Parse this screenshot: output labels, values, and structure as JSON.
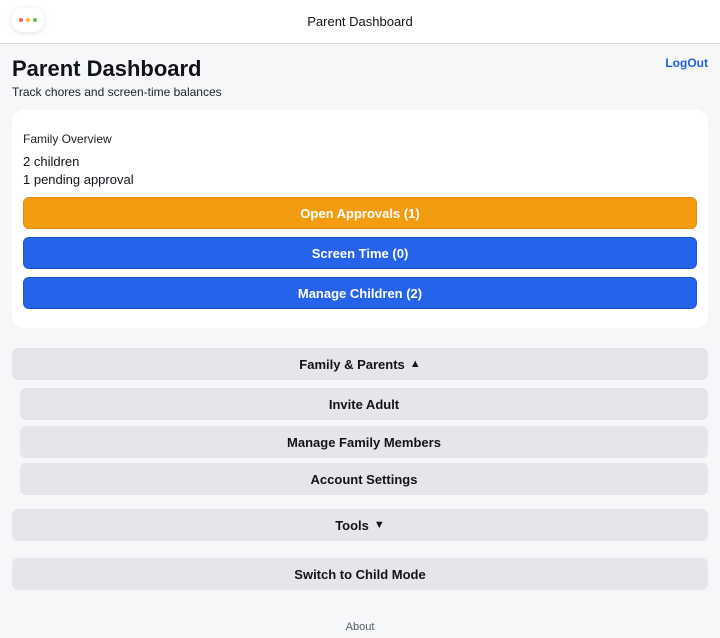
{
  "window": {
    "title": "Parent Dashboard",
    "traffic_colors": [
      "#f25f58",
      "#f7bc2e",
      "#5ac24a"
    ]
  },
  "header": {
    "title": "Parent Dashboard",
    "subtitle": "Track chores and screen-time balances",
    "logout_label": "LogOut"
  },
  "overview": {
    "heading": "Family Overview",
    "children_count": "2 children",
    "pending_text": "1 pending approval",
    "buttons": {
      "approvals": "Open Approvals (1)",
      "screen_time": "Screen Time (0)",
      "manage_children": "Manage Children (2)"
    }
  },
  "family_section": {
    "toggle_label": "Family & Parents",
    "toggle_glyph": "▲",
    "items": [
      "Invite Adult",
      "Manage Family Members",
      "Account Settings"
    ]
  },
  "tools_section": {
    "toggle_label": "Tools",
    "toggle_glyph": "▼"
  },
  "switch_label": "Switch to Child Mode",
  "footer": {
    "about": "About"
  },
  "colors": {
    "accent_orange": "#f39c12",
    "accent_blue": "#2563eb",
    "link_blue": "#1f5fe0",
    "gray_button": "#e5e6e9"
  }
}
